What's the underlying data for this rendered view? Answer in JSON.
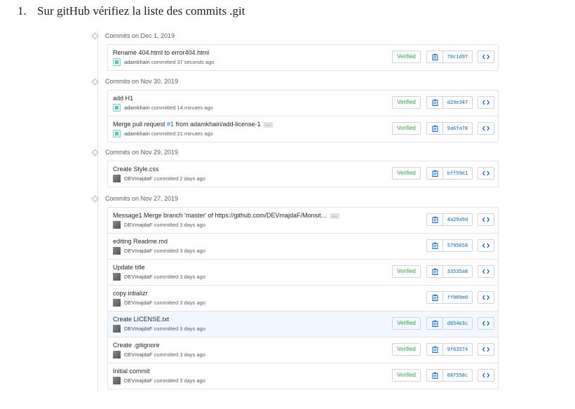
{
  "instruction": {
    "number": "1.",
    "text": "Sur gitHub vérifiez la liste des commits .git"
  },
  "groups": [
    {
      "title": "Commits on Dec 1, 2019",
      "commits": [
        {
          "message": "Rename 404.html to error404.html",
          "author": "adamkhairi",
          "time": "committed 37 seconds ago",
          "verified": "Verified",
          "sha": "70c1d9f"
        }
      ]
    },
    {
      "title": "Commits on Nov 30, 2019",
      "commits": [
        {
          "message": "add H1",
          "author": "adamkhairi",
          "time": "committed 14 minutes ago",
          "verified": "Verified",
          "sha": "d29e347"
        },
        {
          "message_pre": "Merge pull request ",
          "issue": "#1",
          "message_post": " from adamkhairi/add-license-1",
          "ellipsis": "…",
          "author": "adamkhairi",
          "time": "committed 21 minutes ago",
          "verified": "Verified",
          "sha": "9a6fa78"
        }
      ]
    },
    {
      "title": "Commits on Nov 29, 2019",
      "commits": [
        {
          "message": "Create Style.css",
          "author": "DEVmajdaF",
          "time": "committed 2 days ago",
          "verified": "Verified",
          "sha": "bff59e1"
        }
      ]
    },
    {
      "title": "Commits on Nov 27, 2019",
      "commits": [
        {
          "message": "Message1 Merge branch 'master' of https://github.com/DEVmajdaF/Monsit…",
          "ellipsis": "…",
          "author": "DEVmajdaF",
          "time": "committed 3 days ago",
          "sha": "4a29a9d"
        },
        {
          "message": "editing Readme.md",
          "author": "DEVmajdaF",
          "time": "committed 3 days ago",
          "sha": "5795658"
        },
        {
          "message": "Update title",
          "author": "DEVmajdaF",
          "time": "committed 3 days ago",
          "verified": "Verified",
          "sha": "33535a8"
        },
        {
          "message": "copy intializr",
          "author": "DEVmajdaF",
          "time": "committed 3 days ago",
          "sha": "ff069e0"
        },
        {
          "message": "Create LICENSE.txt",
          "author": "DEVmajdaF",
          "time": "committed 3 days ago",
          "verified": "Verified",
          "sha": "d654e3c"
        },
        {
          "message": "Create .gitignore",
          "author": "DEVmajdaF",
          "time": "committed 3 days ago",
          "verified": "Verified",
          "sha": "9f63574"
        },
        {
          "message": "Initial commit",
          "author": "DEVmajdaF",
          "time": "committed 3 days ago",
          "verified": "Verified",
          "sha": "687558c"
        }
      ]
    }
  ],
  "colors": {
    "verified": "#28a745",
    "link": "#0366d6",
    "border": "#e1e4e8",
    "highlight_row": "#f1f8ff"
  }
}
